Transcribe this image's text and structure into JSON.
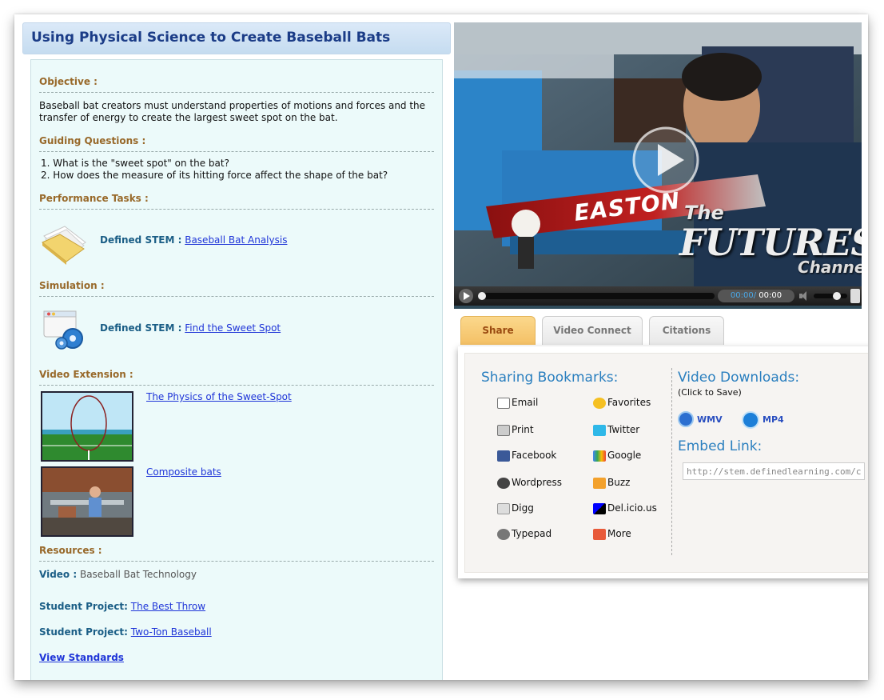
{
  "header": {
    "title": "Using Physical Science to Create Baseball Bats"
  },
  "objective": {
    "label": "Objective :",
    "text": "Baseball bat creators must understand properties of motions and forces and the transfer of energy to create the largest sweet spot on the bat."
  },
  "guiding": {
    "label": "Guiding Questions :",
    "q1": "1.  What is the \"sweet spot\" on the bat?",
    "q2": "2.  How does the measure of its hitting force affect the shape of the bat?"
  },
  "performance": {
    "label": "Performance Tasks :",
    "item_label": "Defined STEM :",
    "item_link": "Baseball Bat Analysis"
  },
  "simulation": {
    "label": "Simulation :",
    "item_label": "Defined STEM :",
    "item_link": "Find the Sweet Spot"
  },
  "video_extension": {
    "label": "Video Extension :",
    "items": [
      {
        "link": "The Physics of the Sweet-Spot"
      },
      {
        "link": "Composite bats"
      }
    ]
  },
  "resources": {
    "label": "Resources :",
    "video_label": "Video :",
    "video_text": "Baseball Bat Technology",
    "proj1_label": "Student Project:",
    "proj1_link": "The Best Throw",
    "proj2_label": "Student Project:",
    "proj2_link": "Two-Ton Baseball",
    "standards_link": "View Standards"
  },
  "player": {
    "time_current": "00:00",
    "time_sep": "/",
    "time_total": "00:00",
    "overlay_text_1": "The",
    "overlay_text_2": "FUTURES",
    "overlay_text_3": "Channel",
    "bat_text": "EASTON"
  },
  "tabs": [
    {
      "label": "Share"
    },
    {
      "label": "Video Connect"
    },
    {
      "label": "Citations"
    }
  ],
  "share": {
    "bookmarks_title": "Sharing Bookmarks:",
    "left_items": [
      "Email",
      "Print",
      "Facebook",
      "Wordpress",
      "Digg",
      "Typepad"
    ],
    "right_items": [
      "Favorites",
      "Twitter",
      "Google",
      "Buzz",
      "Del.icio.us",
      "More"
    ],
    "downloads_title": "Video Downloads:",
    "downloads_sub": "(Click to Save)",
    "wmv": "WMV",
    "mp4": "MP4",
    "embed_title": "Embed Link:",
    "embed_value": "http://stem.definedlearning.com/cor"
  }
}
